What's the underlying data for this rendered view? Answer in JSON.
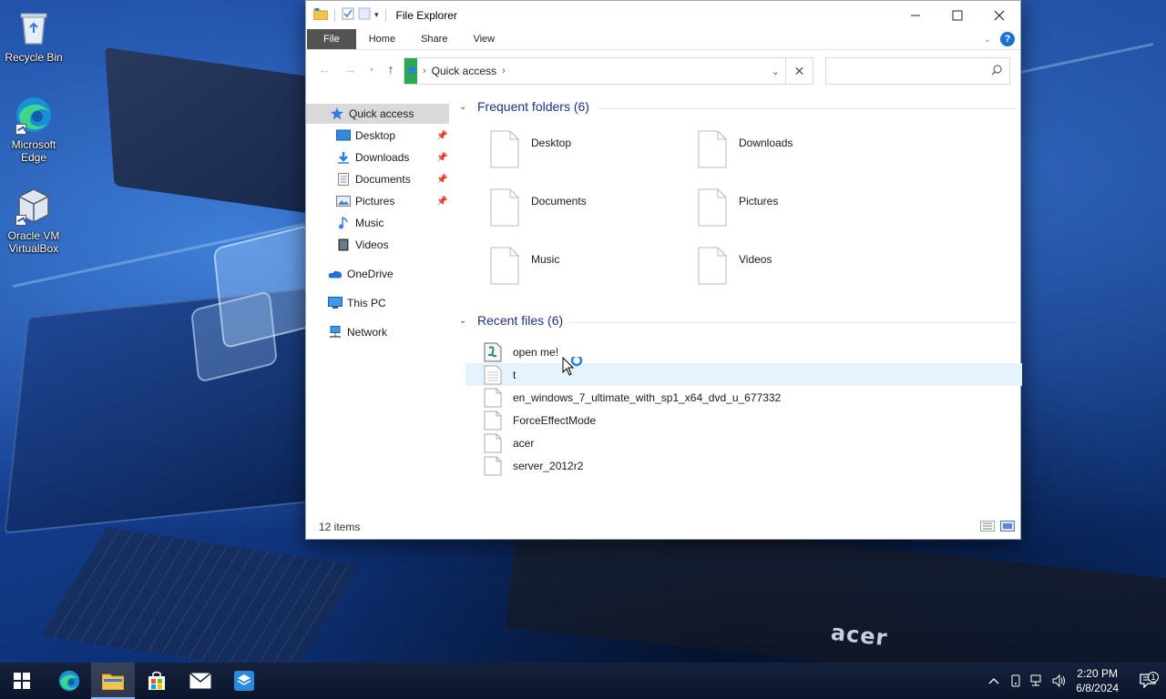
{
  "desktop": {
    "icons": [
      {
        "label": "Recycle Bin",
        "icon": "recycle-bin-icon"
      },
      {
        "label": "Microsoft Edge",
        "icon": "edge-icon"
      },
      {
        "label": "Oracle VM VirtualBox",
        "icon": "virtualbox-icon"
      }
    ],
    "wallpaper_brand": "acer"
  },
  "window": {
    "title": "File Explorer",
    "ribbon_tabs": [
      "File",
      "Home",
      "Share",
      "View"
    ],
    "help_label": "?",
    "address": {
      "breadcrumb": "Quick access",
      "icon": "quick-access-star-icon"
    },
    "search": {
      "placeholder": ""
    }
  },
  "nav_pane": {
    "items": [
      {
        "label": "Quick access",
        "icon": "star-icon",
        "selected": true
      },
      {
        "label": "Desktop",
        "icon": "desktop-icon",
        "pinned": true
      },
      {
        "label": "Downloads",
        "icon": "downloads-icon",
        "pinned": true
      },
      {
        "label": "Documents",
        "icon": "documents-icon",
        "pinned": true
      },
      {
        "label": "Pictures",
        "icon": "pictures-icon",
        "pinned": true
      },
      {
        "label": "Music",
        "icon": "music-icon"
      },
      {
        "label": "Videos",
        "icon": "videos-icon"
      },
      {
        "label": "OneDrive",
        "icon": "onedrive-icon"
      },
      {
        "label": "This PC",
        "icon": "this-pc-icon"
      },
      {
        "label": "Network",
        "icon": "network-icon"
      }
    ]
  },
  "content": {
    "frequent": {
      "header": "Frequent folders (6)",
      "folders": [
        "Desktop",
        "Downloads",
        "Documents",
        "Pictures",
        "Music",
        "Videos"
      ]
    },
    "recent": {
      "header": "Recent files (6)",
      "files": [
        "open me!",
        "t",
        "en_windows_7_ultimate_with_sp1_x64_dvd_u_677332",
        "ForceEffectMode",
        "acer",
        "server_2012r2"
      ]
    }
  },
  "status": {
    "items_count": "12 items"
  },
  "taskbar": {
    "apps": [
      "start-icon",
      "edge-icon",
      "file-explorer-icon",
      "store-icon",
      "mail-icon",
      "virtualbox-icon"
    ],
    "clock": {
      "time": "2:20 PM",
      "date": "6/8/2024"
    },
    "notification_count": "1"
  },
  "colors": {
    "accent": "#1e3287",
    "selection": "#d9d9d9",
    "hover": "#e5f3ff",
    "taskbar": "#0e1a33"
  }
}
